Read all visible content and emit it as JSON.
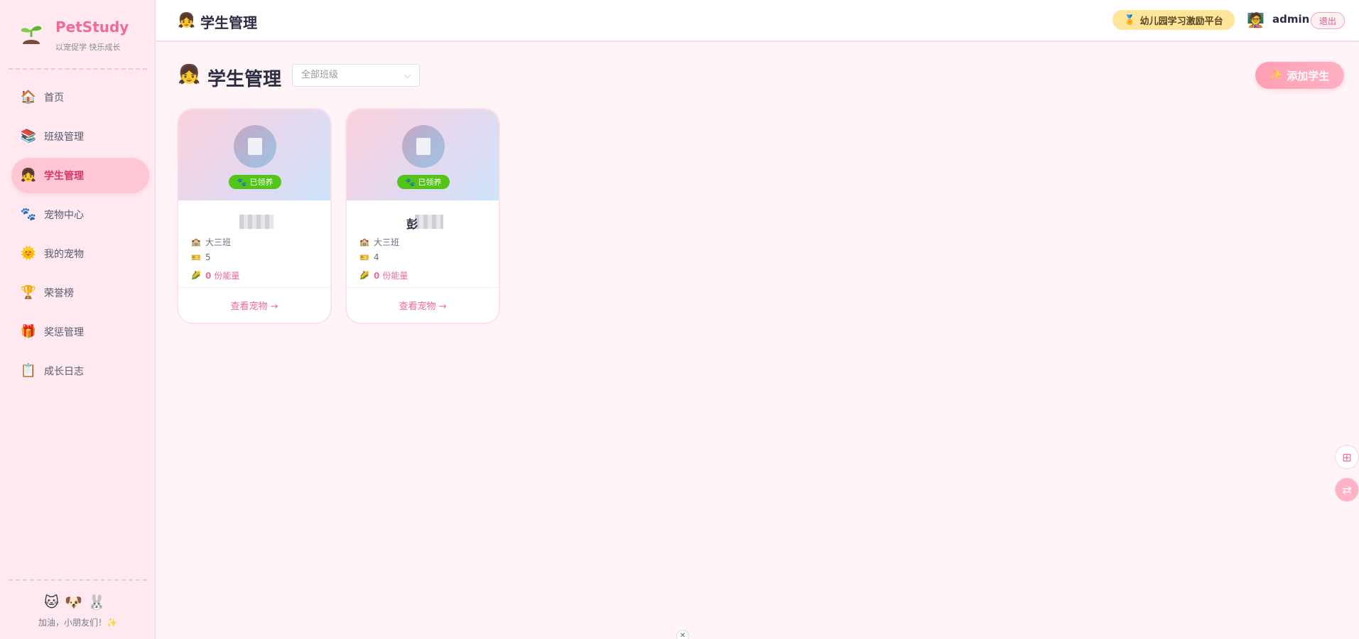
{
  "sidebar": {
    "brand": {
      "name": "PetStudy",
      "slogan": "以宠促学 快乐成长"
    },
    "items": [
      {
        "label": "首页",
        "icon": "🏠"
      },
      {
        "label": "班级管理",
        "icon": "📚"
      },
      {
        "label": "学生管理",
        "icon": "👧",
        "active": true
      },
      {
        "label": "宠物中心",
        "icon": "🐾"
      },
      {
        "label": "我的宠物",
        "icon": "🌞"
      },
      {
        "label": "荣誉榜",
        "icon": "🏆"
      },
      {
        "label": "奖惩管理",
        "icon": "🎁"
      },
      {
        "label": "成长日志",
        "icon": "📋"
      }
    ],
    "footer": {
      "pets": "🐱🐶🐰",
      "cheer": "加油，小朋友们！✨"
    }
  },
  "topbar": {
    "icon": "👧",
    "title": "学生管理",
    "platform_badge": "幼儿园学习激励平台",
    "platform_icon": "🏅",
    "avatar_icon": "🧑‍🏫",
    "username": "admin",
    "logout": "退出"
  },
  "main": {
    "icon": "👧",
    "title": "学生管理",
    "class_select_placeholder": "全部班级",
    "add_student": "添加学生",
    "add_icon": "✨"
  },
  "students": [
    {
      "name": "",
      "adopted": "已领养",
      "class": "大三班",
      "number": "5",
      "energy": "0",
      "energy_label": "份能量",
      "view_pet": "查看宠物 →"
    },
    {
      "name": "彭",
      "adopted": "已领养",
      "class": "大三班",
      "number": "4",
      "energy": "0",
      "energy_label": "份能量",
      "view_pet": "查看宠物 →"
    }
  ],
  "colors": {
    "accent": "#f06a94",
    "adopted": "#52c41a",
    "sidebar_bg": "#fde9ef"
  }
}
